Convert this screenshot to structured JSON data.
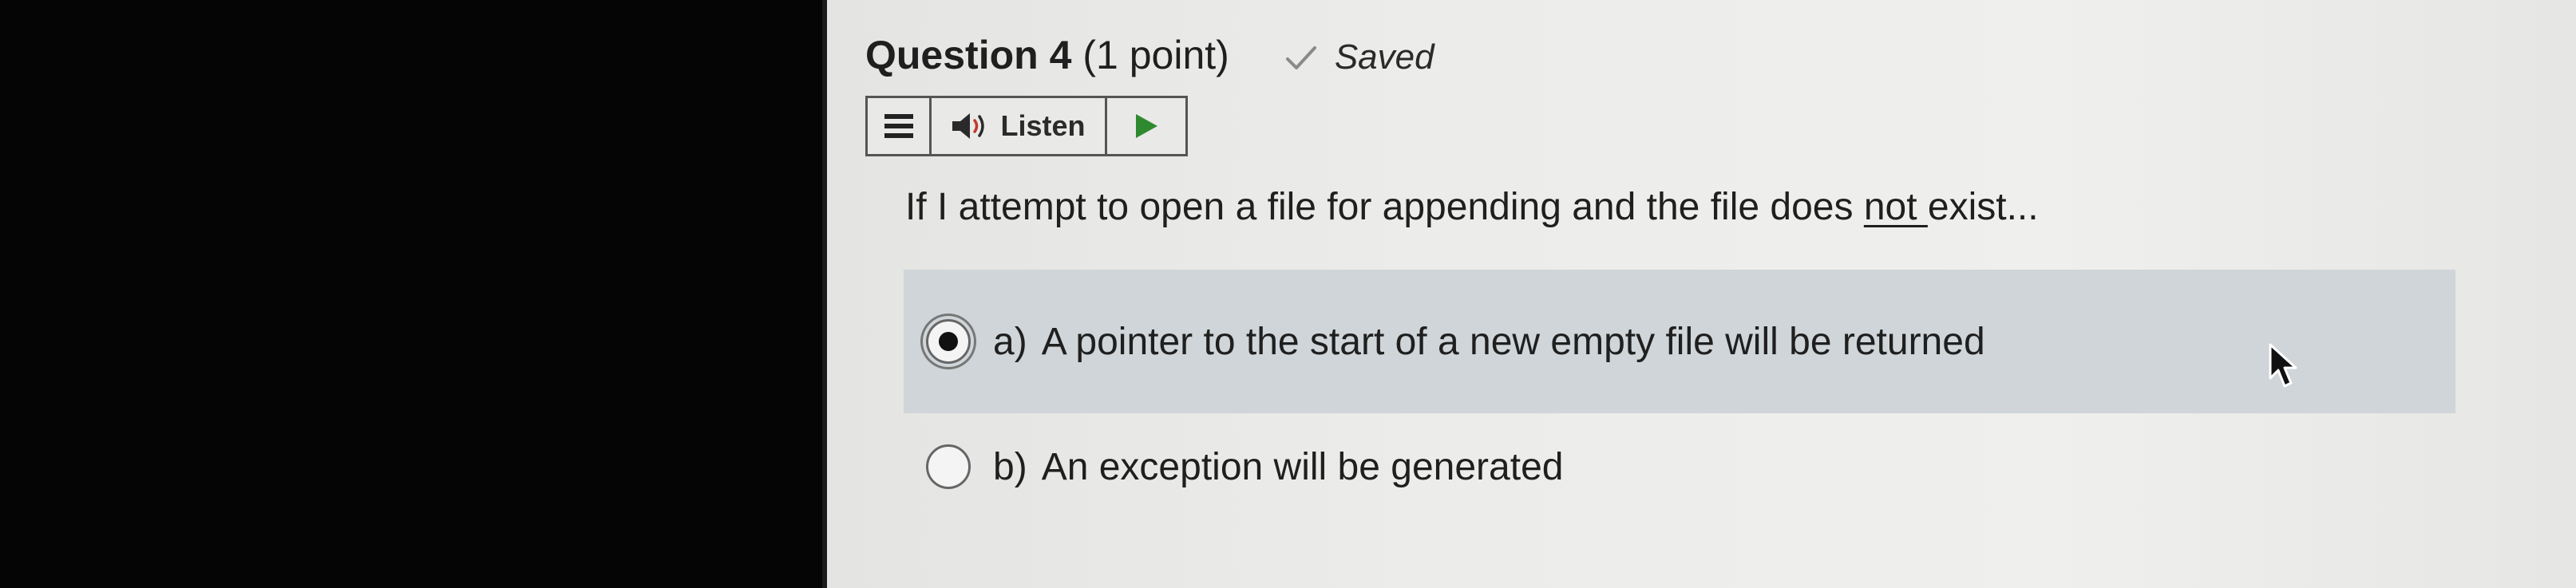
{
  "question": {
    "title": "Question 4",
    "points": "(1 point)",
    "status_icon": "check-icon",
    "status": "Saved",
    "text_before": "If I attempt to open a file for appending and the file does ",
    "text_underlined": "not ",
    "text_after": "exist..."
  },
  "toolbar": {
    "menu_icon": "hamburger-menu-icon",
    "listen_icon": "speaker-icon",
    "listen_label": "Listen",
    "play_icon": "play-icon"
  },
  "options": [
    {
      "letter": "a)",
      "text": "A pointer to the start of a new empty file will be returned",
      "selected": true
    },
    {
      "letter": "b)",
      "text": "An exception will be generated",
      "selected": false
    }
  ],
  "colors": {
    "selected_row_bg": "#cfd5d8",
    "play_accent": "#2f8a2f",
    "speaker_accent": "#c0392b"
  }
}
